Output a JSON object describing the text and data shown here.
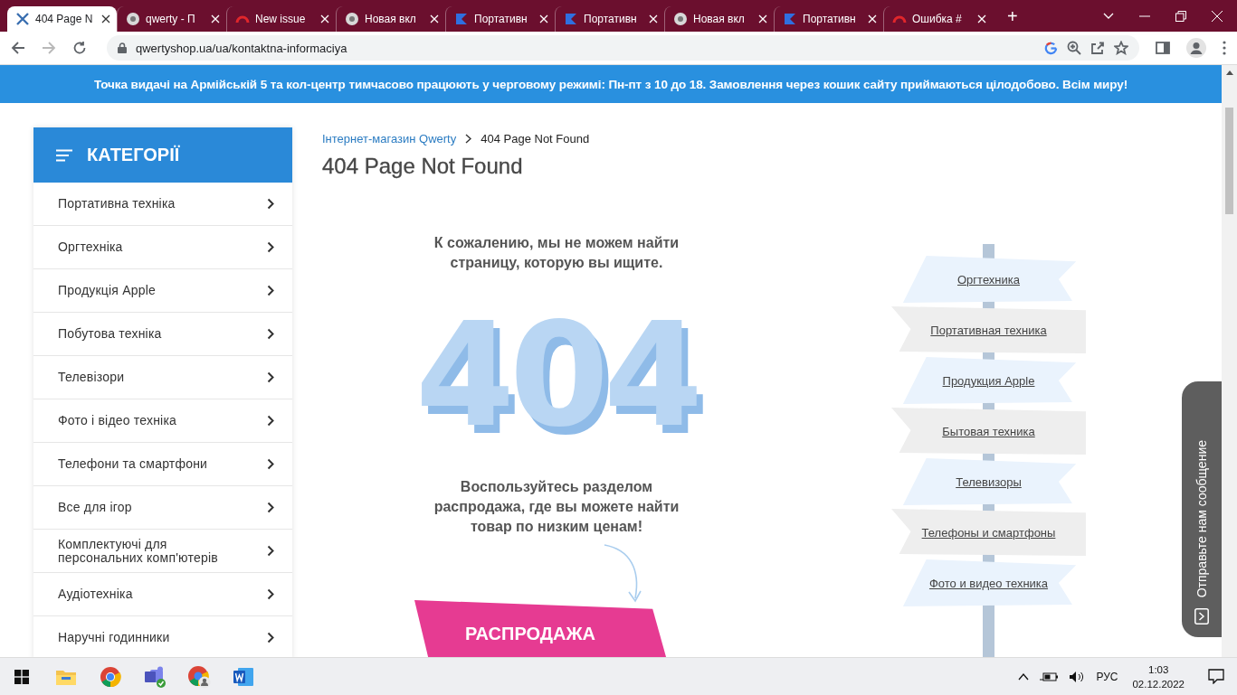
{
  "browser": {
    "tabs": [
      {
        "title": "404 Page N",
        "selected": true,
        "kind": "cross"
      },
      {
        "title": "qwerty - П",
        "selected": false,
        "kind": "globe"
      },
      {
        "title": "New issue",
        "selected": false,
        "kind": "arc"
      },
      {
        "title": "Новая вкл",
        "selected": false,
        "kind": "globe"
      },
      {
        "title": "Портативн",
        "selected": false,
        "kind": "flag"
      },
      {
        "title": "Портативн",
        "selected": false,
        "kind": "flag"
      },
      {
        "title": "Новая вкл",
        "selected": false,
        "kind": "globe"
      },
      {
        "title": "Портативн",
        "selected": false,
        "kind": "flag"
      },
      {
        "title": "Ошибка #",
        "selected": false,
        "kind": "arc"
      }
    ],
    "new_tab": "+",
    "address": {
      "url": "qwertyshop.ua/ua/kontaktna-informaciya"
    }
  },
  "banner": {
    "text": "Точка видачі на Армійській 5 та кол-центр тимчасово працюють у черговому режимі: Пн-пт з 10 до 18. Замовлення через кошик сайту приймаються цілодобово. Всім миру!"
  },
  "sidebar": {
    "title": "КАТЕГОРІЇ",
    "items": [
      "Портативна техніка",
      "Оргтехніка",
      "Продукція Apple",
      "Побутова техніка",
      "Телевізори",
      "Фото і відео техніка",
      "Телефони та смартфони",
      "Все для ігор",
      "Комплектуючі для персональних комп'ютерів",
      "Аудіотехніка",
      "Наручні годинники"
    ]
  },
  "breadcrumb": {
    "items": [
      "Інтернет-магазин Qwerty",
      "404 Page Not Found"
    ]
  },
  "title": "404 Page Not Found",
  "illustration": {
    "message": "К сожалению, мы не можем найти страницу, которую вы ищите.",
    "graphic": "404",
    "hint": "Воспользуйтесь разделом распродажа, где вы можете найти товар по низким ценам!",
    "sale_button": "РАСПРОДАЖА"
  },
  "signpost": [
    {
      "label": "Оргтехника",
      "kind": "right"
    },
    {
      "label": "Портативная техника",
      "kind": "left"
    },
    {
      "label": "Продукция Apple",
      "kind": "right"
    },
    {
      "label": "Бытовая техника",
      "kind": "left"
    },
    {
      "label": "Телевизоры",
      "kind": "right"
    },
    {
      "label": "Телефоны и смартфоны",
      "kind": "left"
    },
    {
      "label": "Фото и видео техника",
      "kind": "right"
    }
  ],
  "feedback_tab": {
    "label": "Отправьте нам сообщение"
  },
  "taskbar": {
    "apps": [
      {
        "kind": "folder"
      },
      {
        "kind": "chrome"
      },
      {
        "kind": "teams"
      },
      {
        "kind": "chrome-profile"
      },
      {
        "kind": "word"
      }
    ],
    "tray": {
      "language": "РУС",
      "time": "1:03",
      "date": "02.12.2022"
    }
  }
}
